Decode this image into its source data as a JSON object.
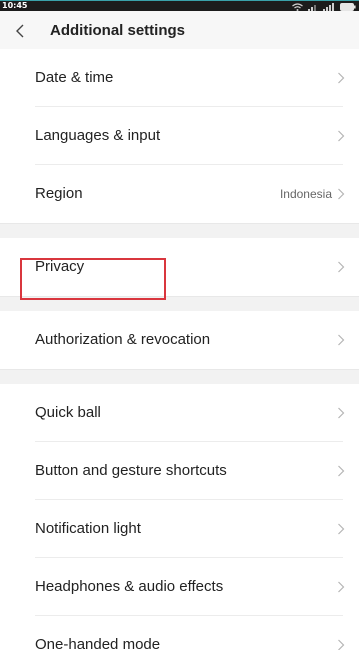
{
  "status_bar": {
    "time": "10:45",
    "icons": [
      "wifi-icon",
      "signal-icon",
      "signal-icon",
      "battery-icon"
    ]
  },
  "header": {
    "back_icon": "chevron-left-icon",
    "title": "Additional settings"
  },
  "groups": [
    {
      "items": [
        {
          "label": "Date & time"
        },
        {
          "label": "Languages & input"
        },
        {
          "label": "Region",
          "value": "Indonesia"
        }
      ]
    },
    {
      "items": [
        {
          "label": "Privacy",
          "highlighted": true
        }
      ]
    },
    {
      "items": [
        {
          "label": "Authorization & revocation"
        }
      ]
    },
    {
      "items": [
        {
          "label": "Quick ball"
        },
        {
          "label": "Button and gesture shortcuts"
        },
        {
          "label": "Notification light"
        },
        {
          "label": "Headphones & audio effects"
        },
        {
          "label": "One-handed mode"
        }
      ]
    }
  ],
  "colors": {
    "status_bar": "#1c1c1c",
    "status_accent": "#3aa1a9",
    "header_bg": "#f7f7f7",
    "highlight": "#d9363e",
    "chevron": "#b5b5b5"
  }
}
